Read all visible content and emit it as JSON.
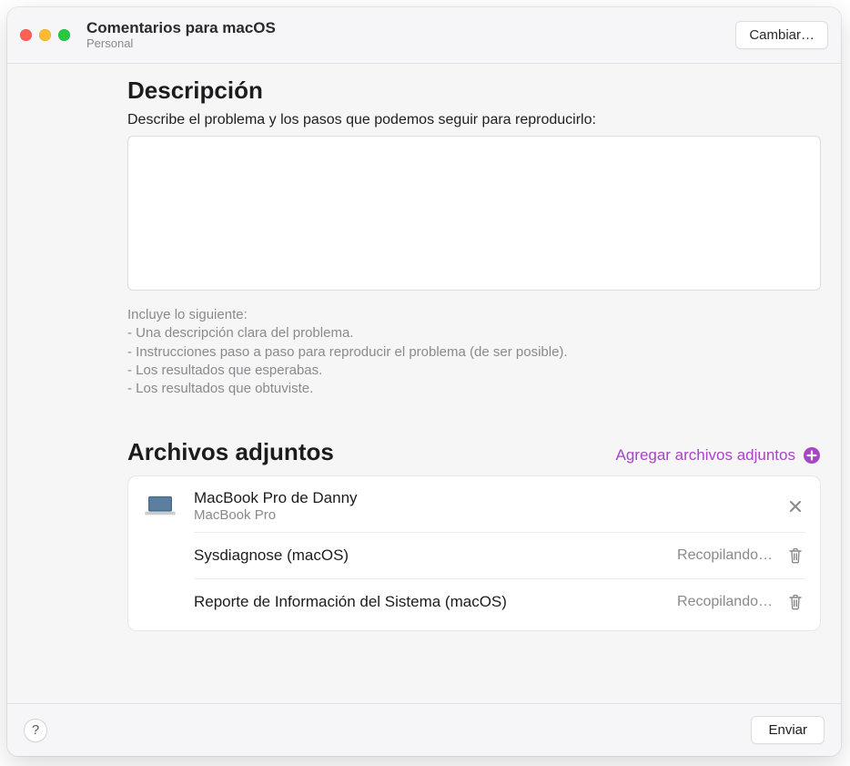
{
  "colors": {
    "accent_purple": "#a944c6"
  },
  "titlebar": {
    "title": "Comentarios para macOS",
    "subtitle": "Personal",
    "change_label": "Cambiar…"
  },
  "description": {
    "section_title": "Descripción",
    "field_label": "Describe el problema y los pasos que podemos seguir para reproducirlo:",
    "value": "",
    "hints_title": "Incluye lo siguiente:",
    "hints": [
      "- Una descripción clara del problema.",
      "- Instrucciones paso a paso para reproducir el problema (de ser posible).",
      "- Los resultados que esperabas.",
      "- Los resultados que obtuviste."
    ]
  },
  "attachments": {
    "section_title": "Archivos adjuntos",
    "add_label": "Agregar archivos adjuntos",
    "device": {
      "name": "MacBook Pro de Danny",
      "model": "MacBook Pro"
    },
    "items": [
      {
        "name": "Sysdiagnose (macOS)",
        "status": "Recopilando…"
      },
      {
        "name": "Reporte de Información del Sistema (macOS)",
        "status": "Recopilando…"
      }
    ]
  },
  "bottombar": {
    "help_label": "?",
    "send_label": "Enviar"
  }
}
